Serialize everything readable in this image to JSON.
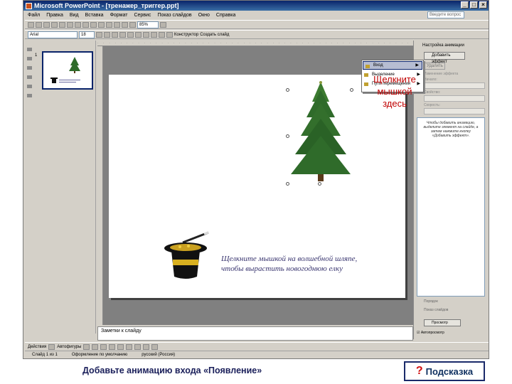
{
  "window": {
    "title": "Microsoft PowerPoint - [тренажер_триггер.ppt]",
    "controls": [
      "_",
      "□",
      "×"
    ]
  },
  "menubar": {
    "items": [
      "Файл",
      "Правка",
      "Вид",
      "Вставка",
      "Формат",
      "Сервис",
      "Показ слайдов",
      "Окно",
      "Справка"
    ],
    "help_placeholder": "Введите вопрос"
  },
  "toolbar": {
    "zoom": "85%",
    "font": "Arial",
    "size": "18",
    "constructor_label": "Конструктор",
    "create_slide_label": "Создать слайд"
  },
  "thumbnails": {
    "slide_number": "1"
  },
  "slide": {
    "caption_line1": "Щелкните мышкой на волшебной шляпе,",
    "caption_line2": "чтобы вырастить новогоднюю елку"
  },
  "notes": {
    "placeholder": "Заметки к слайду"
  },
  "task_pane": {
    "title": "Настройка анимации",
    "add_effect": "Добавить эффект",
    "delete": "Удалить",
    "label_change": "Изменение эффекта",
    "label_start": "Начало:",
    "label_property": "Свойство:",
    "label_speed": "Скорость:",
    "list_hint": "Чтобы добавить анимацию, выделите элемент на слайде, а затем нажмите кнопку «Добавить эффект».",
    "reorder": "Порядок",
    "play": "Просмотр",
    "slideshow": "Показ слайдов",
    "autopreview": "Автопросмотр"
  },
  "effect_menu": {
    "items": [
      {
        "label": "Вход",
        "highlighted": true
      },
      {
        "label": "Выделение",
        "highlighted": false
      },
      {
        "label": "Выход",
        "highlighted": false
      },
      {
        "label": "Пути перемещения",
        "highlighted": false
      }
    ]
  },
  "callout": {
    "line1": "Щелкните",
    "line2": "мышкой",
    "line3": "здесь"
  },
  "drawing_toolbar": {
    "draw_label": "Действия",
    "autoshapes_label": "Автофигуры"
  },
  "statusbar": {
    "slide": "Слайд 1 из 1",
    "design": "Оформление по умолчанию",
    "language": "русский (Россия)"
  },
  "footer": {
    "instruction": "Добавьте анимацию входа «Появление»",
    "hint_symbol": "?",
    "hint_label": "Подсказка"
  },
  "colors": {
    "title_bar": "#0a246a",
    "callout": "#c00000",
    "caption": "#3a3670",
    "tree": "#2f6b2a",
    "hint_border": "#1a2a6a"
  }
}
